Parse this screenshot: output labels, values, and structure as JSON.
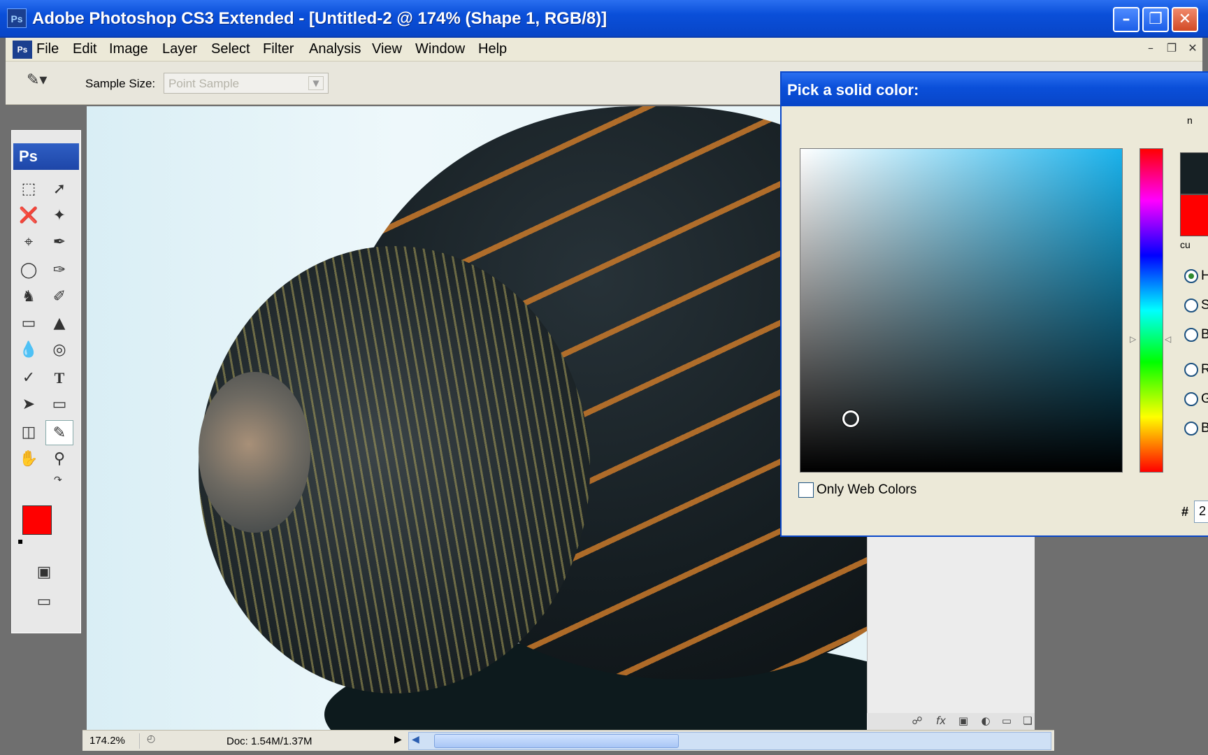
{
  "window": {
    "title": "Adobe Photoshop CS3 Extended - [Untitled-2 @ 174% (Shape 1, RGB/8)]",
    "app_icon": "Ps",
    "doc_icon": "Ps",
    "buttons": {
      "minimize": "minimize-icon",
      "maximize": "maximize-icon",
      "close": "close-icon"
    }
  },
  "menu": {
    "items": [
      "File",
      "Edit",
      "Image",
      "Layer",
      "Select",
      "Filter",
      "Analysis",
      "View",
      "Window",
      "Help"
    ]
  },
  "options": {
    "sample_size_label": "Sample Size:",
    "sample_size_value": "Point Sample"
  },
  "toolbox": {
    "header": "Ps",
    "foreground_color": "#ff0000",
    "background_color": "#ffffff",
    "active_tool": "eyedropper"
  },
  "status": {
    "zoom": "174.2%",
    "doc_size": "Doc: 1.54M/1.37M"
  },
  "color_picker": {
    "title": "Pick a solid color:",
    "only_web_colors_label": "Only Web Colors",
    "only_web_colors_checked": false,
    "new_color": "#162024",
    "current_color": "#ff0000",
    "hue_color": "#1ab2ec",
    "clip_label": "n",
    "current_label": "cu",
    "radio_labels": [
      "H",
      "S",
      "B",
      "R",
      "G",
      "B"
    ],
    "selected_radio": "H",
    "hex_label": "#",
    "hex_value": "2"
  }
}
